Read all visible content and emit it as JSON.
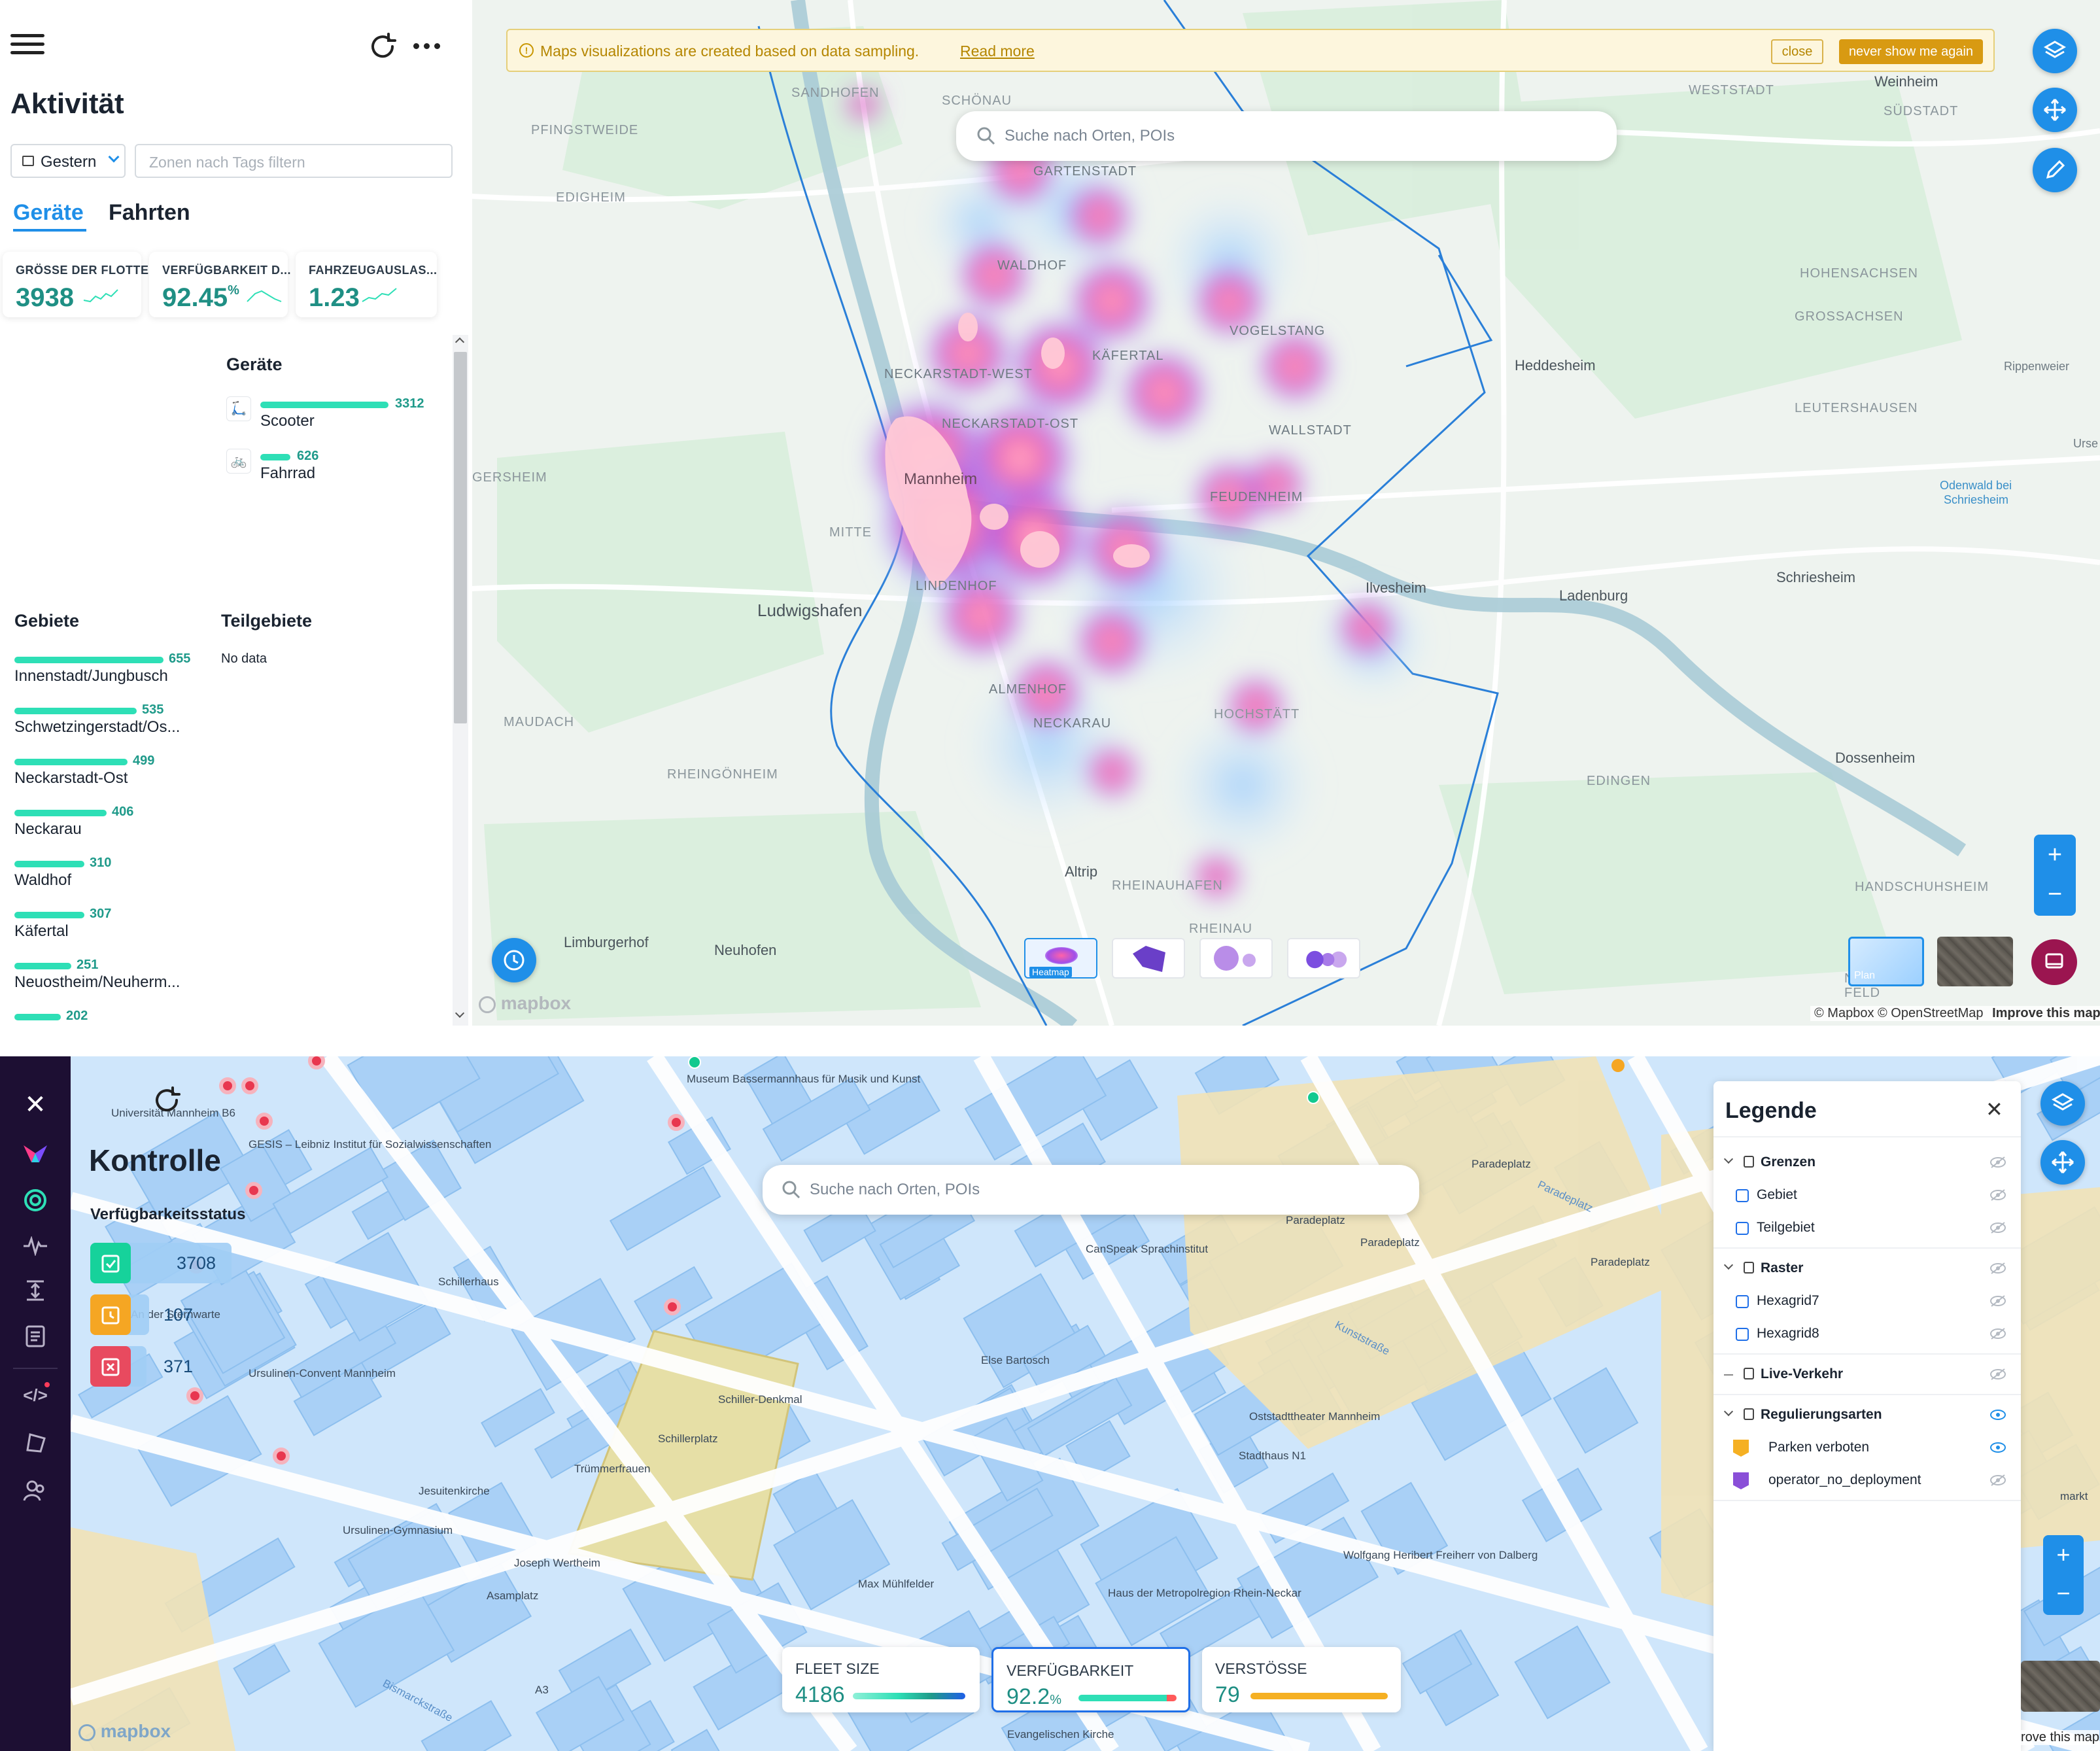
{
  "top": {
    "title": "Aktivität",
    "date_select": "Gestern",
    "tag_filter_placeholder": "Zonen nach Tags filtern",
    "tabs": [
      "Geräte",
      "Fahrten"
    ],
    "kpis": [
      {
        "label": "GRÖSSE DER FLOTTE",
        "value": "3938",
        "unit": ""
      },
      {
        "label": "VERFÜGBARKEIT D...",
        "value": "92.45",
        "unit": "%"
      },
      {
        "label": "FAHRZEUGAUSLAS...",
        "value": "1.23",
        "unit": ""
      }
    ],
    "devices_title": "Geräte",
    "devices": [
      {
        "name": "Scooter",
        "value": "3312",
        "fraction": 1.0
      },
      {
        "name": "Fahrrad",
        "value": "626",
        "fraction": 0.19
      }
    ],
    "areas_title": "Gebiete",
    "subareas_title": "Teilgebiete",
    "subareas_empty": "No data",
    "areas": [
      {
        "name": "Innenstadt/Jungbusch",
        "value": "655",
        "fraction": 1.0
      },
      {
        "name": "Schwetzingerstadt/Os...",
        "value": "535",
        "fraction": 0.82
      },
      {
        "name": "Neckarstadt-Ost",
        "value": "499",
        "fraction": 0.76
      },
      {
        "name": "Neckarau",
        "value": "406",
        "fraction": 0.62
      },
      {
        "name": "Waldhof",
        "value": "310",
        "fraction": 0.47
      },
      {
        "name": "Käfertal",
        "value": "307",
        "fraction": 0.47
      },
      {
        "name": "Neuostheim/Neuherm...",
        "value": "251",
        "fraction": 0.38
      },
      {
        "name": "",
        "value": "202",
        "fraction": 0.31
      }
    ],
    "banner": {
      "text": "Maps visualizations are created based on data sampling.",
      "link": "Read more",
      "close": "close",
      "never": "never show me again"
    },
    "search_placeholder": "Suche nach Orten, POIs",
    "place_labels": {
      "sandhofen": "SANDHOFEN",
      "schoenau": "SCHÖNAU",
      "pfingstweide": "PFINGSTWEIDE",
      "gartenstadt": "GARTENSTADT",
      "edigheim": "EDIGHEIM",
      "waldhof": "WALDHOF",
      "vogelstang": "VOGELSTANG",
      "kaefertal": "KÄFERTAL",
      "neckarstadt_west": "NECKARSTADT-WEST",
      "neckarstadt_ost": "NECKARSTADT-OST",
      "wallstadt": "WALLSTADT",
      "oggersheim": "GERSHEIM",
      "mannheim": "Mannheim",
      "feudenheim": "FEUDENHEIM",
      "mitte": "MITTE",
      "lindenhof": "LINDENHOF",
      "ludwigshafen": "Ludwigshafen",
      "ilvesheim": "Ilvesheim",
      "ladenburg": "Ladenburg",
      "schriesheim": "Schriesheim",
      "heddesheim": "Heddesheim",
      "weinheim": "Weinheim",
      "weststadt": "WESTSTADT",
      "suedstadt": "SÜDSTADT",
      "hohensachsen": "HOHENSACHSEN",
      "grosssachsen": "GROSSACHSEN",
      "leutershausen": "LEUTERSHAUSEN",
      "rippenweier": "Rippenweier",
      "urse": "Urse",
      "odenwald": "Odenwald bei Schriesheim",
      "almenhof": "ALMENHOF",
      "neckarau": "NECKARAU",
      "hochstaett": "HOCHSTÄTT",
      "maudach": "MAUDACH",
      "rheingoenheim": "RHEINGÖNHEIM",
      "edingen": "EDINGEN",
      "dossenheim": "Dossenheim",
      "altrip": "Altrip",
      "rheinauhafen": "RHEINAUHAFEN",
      "rheinau": "RHEINAU",
      "handschuhsheim": "HANDSCHUHSHEIM",
      "limburgerhof": "Limburgerhof",
      "neuhofen": "Neuhofen",
      "neuenheim": "NEUENHEIM FELD",
      "nheim": "NHEIM"
    },
    "viz_types": [
      "Heatmap",
      "",
      "",
      ""
    ],
    "basemap_plan": "Plan",
    "attribution": "© Mapbox © OpenStreetMap",
    "improve": "Improve this map",
    "mapbox": "mapbox"
  },
  "bottom": {
    "title": "Kontrolle",
    "status_title": "Verfügbarkeitsstatus",
    "statuses": [
      {
        "value": "3708",
        "color": "#16d29b"
      },
      {
        "value": "107",
        "color": "#f5a623"
      },
      {
        "value": "371",
        "color": "#e84a5f"
      }
    ],
    "search_placeholder": "Suche nach Orten, POIs",
    "legend": {
      "title": "Legende",
      "groups": [
        {
          "name": "Grenzen",
          "items": [
            "Gebiet",
            "Teilgebiet"
          ]
        },
        {
          "name": "Raster",
          "items": [
            "Hexagrid7",
            "Hexagrid8"
          ]
        },
        {
          "name": "Live-Verkehr",
          "items": []
        },
        {
          "name": "Regulierungsarten",
          "items": [
            "Parken verboten",
            "operator_no_deployment"
          ]
        }
      ]
    },
    "cards": [
      {
        "label": "FLEET SIZE",
        "value": "4186",
        "unit": ""
      },
      {
        "label": "VERFÜGBARKEIT",
        "value": "92.2",
        "unit": "%"
      },
      {
        "label": "VERSTÖSSE",
        "value": "79",
        "unit": ""
      }
    ],
    "place_labels": {
      "uni": "Universität Mannheim B6",
      "gesis": "GESIS – Leibniz Institut für Sozialwissenschaften",
      "museum": "Museum Bassermannhaus für Musik und Kunst",
      "paradeplatz1": "Paradeplatz",
      "paradeplatz2": "Paradeplatz",
      "paradeplatz3": "Paradeplatz",
      "paradeplatz4": "Paradeplatz",
      "paradeplatz5": "Paradeplatz",
      "schillerhaus": "Schillerhaus",
      "canspeak": "CanSpeak Sprachinstitut",
      "sternwarte": "An der Sternwarte",
      "ursulinen": "Ursulinen-Convent Mannheim",
      "schiller_denkmal": "Schiller-Denkmal",
      "schillerplatz": "Schillerplatz",
      "else": "Else Bartosch",
      "kunststrasse": "Kunststraße",
      "oststadttheater": "Oststadttheater Mannheim",
      "stadthaus": "Stadthaus N1",
      "truemmerfrauen": "Trümmerfrauen",
      "jesuitenkirche": "Jesuitenkirche",
      "ursulinen_gym": "Ursulinen-Gymnasium",
      "wertheim": "Joseph Wertheim",
      "asamplatz": "Asamplatz",
      "muehlfelder": "Max Mühlfelder",
      "metropolregion": "Haus der Metropolregion Rhein-Neckar",
      "dalberg": "Wolfgang Heribert Freiherr von Dalberg",
      "bismarck": "Bismarckstraße",
      "a3": "A3",
      "ev_kirche": "Evangelischen Kirche",
      "markt": "markt",
      "improve": "rove this map"
    },
    "mapbox": "mapbox"
  },
  "colors": {
    "accent": "#1f8fe8",
    "teal": "#2edfb6",
    "sidebar": "#1d0f33"
  }
}
